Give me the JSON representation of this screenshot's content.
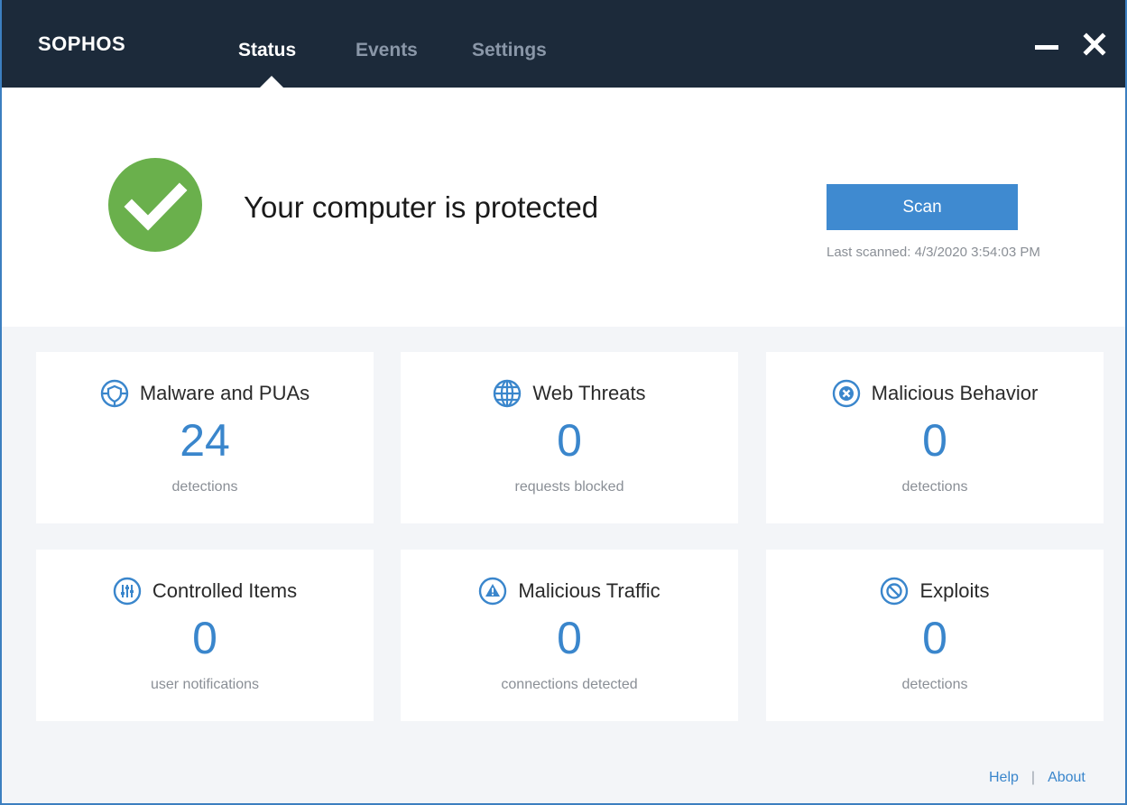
{
  "header": {
    "logo": "SOPHOS",
    "tabs": [
      {
        "label": "Status",
        "active": true
      },
      {
        "label": "Events",
        "active": false
      },
      {
        "label": "Settings",
        "active": false
      }
    ]
  },
  "status": {
    "message": "Your computer is protected",
    "scan_label": "Scan",
    "last_scanned": "Last scanned: 4/3/2020 3:54:03 PM"
  },
  "cards": [
    {
      "title": "Malware and PUAs",
      "value": "24",
      "sub": "detections",
      "icon": "shield-icon"
    },
    {
      "title": "Web Threats",
      "value": "0",
      "sub": "requests blocked",
      "icon": "globe-icon"
    },
    {
      "title": "Malicious Behavior",
      "value": "0",
      "sub": "detections",
      "icon": "x-circle-icon"
    },
    {
      "title": "Controlled Items",
      "value": "0",
      "sub": "user notifications",
      "icon": "sliders-icon"
    },
    {
      "title": "Malicious Traffic",
      "value": "0",
      "sub": "connections detected",
      "icon": "warning-icon"
    },
    {
      "title": "Exploits",
      "value": "0",
      "sub": "detections",
      "icon": "prohibited-icon"
    }
  ],
  "footer": {
    "help": "Help",
    "separator": "|",
    "about": "About"
  },
  "colors": {
    "header_bg": "#1c2a3a",
    "accent_blue": "#3a86cc",
    "success_green": "#6ab04c",
    "panel_bg": "#f3f5f8"
  }
}
